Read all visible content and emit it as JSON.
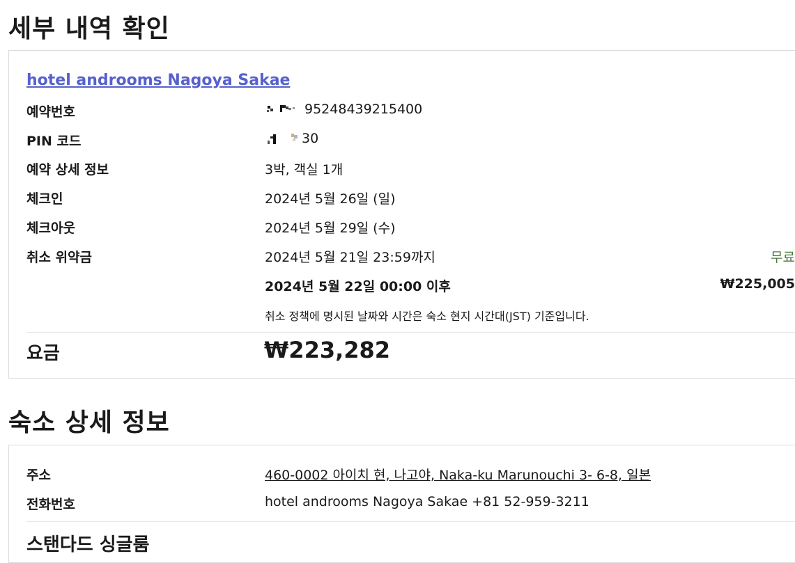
{
  "booking_section": {
    "title": "세부 내역 확인",
    "hotel_name": "hotel androoms Nagoya Sakae",
    "rows": {
      "booking_number": {
        "label": "예약번호",
        "value": "95248439215400"
      },
      "pin_code": {
        "label": "PIN 코드",
        "value": "30"
      },
      "booking_details": {
        "label": "예약 상세 정보",
        "value": "3박, 객실 1개"
      },
      "checkin": {
        "label": "체크인",
        "value": "2024년 5월 26일 (일)"
      },
      "checkout": {
        "label": "체크아웃",
        "value": "2024년 5월 29일 (수)"
      },
      "cancellation": {
        "label": "취소 위약금",
        "tier1_date": "2024년 5월 21일 23:59까지",
        "tier1_fee": "무료",
        "tier2_date": "2024년 5월 22일 00:00 이후",
        "tier2_fee": "₩225,005",
        "note": "취소 정책에 명시된 날짜와 시간은 숙소 현지 시간대(JST) 기준입니다."
      }
    },
    "price": {
      "label": "요금",
      "value": "₩223,282"
    }
  },
  "property_section": {
    "title": "숙소 상세 정보",
    "address": {
      "label": "주소",
      "value": "460-0002 아이치 현, 나고야, Naka-ku Marunouchi 3- 6-8, 일본"
    },
    "phone": {
      "label": "전화번호",
      "value": "hotel androoms Nagoya Sakae +81 52-959-3211"
    },
    "room_name": "스탠다드 싱글룸"
  },
  "colors": {
    "link": "#5661cc",
    "free_green": "#4c7a3c",
    "border": "#dcdcdc"
  }
}
